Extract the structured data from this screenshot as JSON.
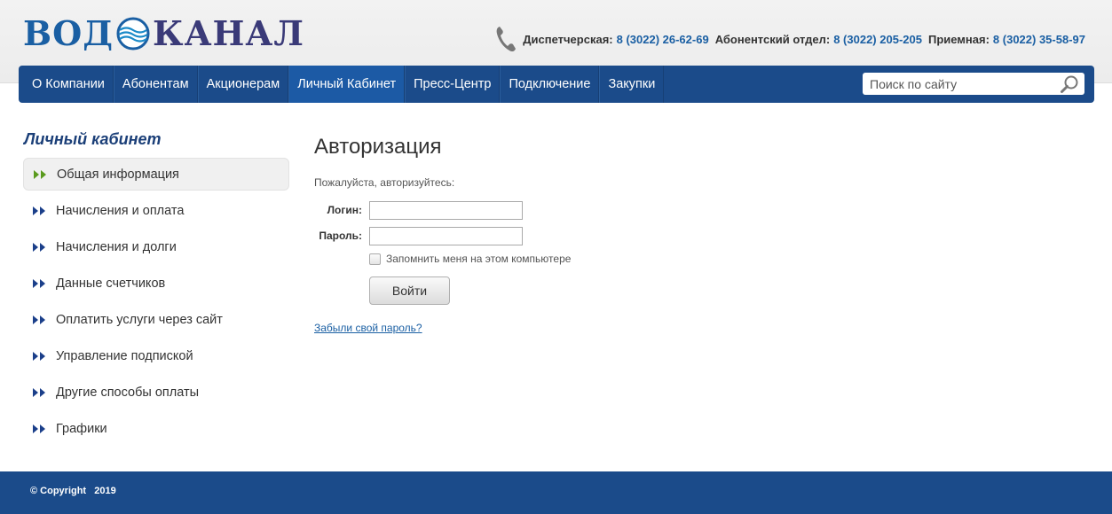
{
  "header": {
    "logo_left": "ВОД",
    "logo_right": "КАНАЛ",
    "phones": [
      {
        "label": "Диспетчерская:",
        "number": "8 (3022) 26-62-69"
      },
      {
        "label": "Абонентский отдел:",
        "number": "8 (3022) 205-205"
      },
      {
        "label": "Приемная:",
        "number": "8 (3022) 35-58-97"
      }
    ]
  },
  "nav": {
    "items": [
      {
        "label": "О Компании"
      },
      {
        "label": "Абонентам"
      },
      {
        "label": "Акционерам"
      },
      {
        "label": "Личный Кабинет"
      },
      {
        "label": "Пресс-Центр"
      },
      {
        "label": "Подключение"
      },
      {
        "label": "Закупки"
      }
    ],
    "search_placeholder": "Поиск по сайту"
  },
  "sidebar": {
    "title": "Личный кабинет",
    "items": [
      {
        "label": "Общая информация"
      },
      {
        "label": "Начисления и оплата"
      },
      {
        "label": "Начисления и долги"
      },
      {
        "label": "Данные счетчиков"
      },
      {
        "label": "Оплатить услуги через сайт"
      },
      {
        "label": "Управление подпиской"
      },
      {
        "label": "Другие способы оплаты"
      },
      {
        "label": "Графики"
      }
    ]
  },
  "main": {
    "title": "Авторизация",
    "hint": "Пожалуйста, авторизуйтесь:",
    "login_label": "Логин:",
    "login_value": "",
    "password_label": "Пароль:",
    "password_value": "",
    "remember_label": "Запомнить меня на этом компьютере",
    "submit_label": "Войти",
    "forgot_label": "Забыли свой пароль?"
  },
  "footer": {
    "copyright": "© Copyright   2019"
  },
  "colors": {
    "brand_blue": "#1b4b8a",
    "active_nav": "#1c5aa5",
    "link_blue": "#1a5fa3",
    "arrow_active": "#5a9a1e",
    "arrow_default": "#1b3f8a"
  },
  "icons": {
    "phone": "phone-icon",
    "search": "search-icon",
    "arrows": "double-arrow-icon"
  }
}
